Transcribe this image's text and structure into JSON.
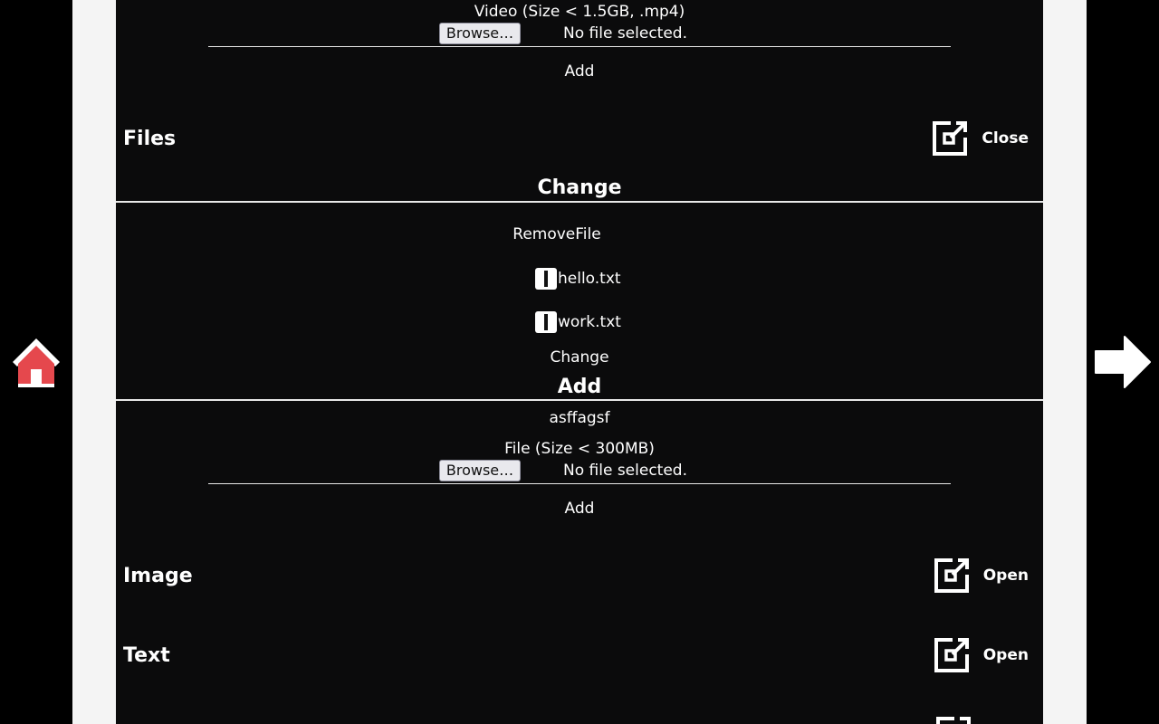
{
  "video_upload": {
    "label": "Video (Size < 1.5GB, .mp4)",
    "browse_label": "Browse…",
    "status": "No file selected.",
    "add_label": "Add"
  },
  "sections": {
    "files": {
      "title": "Files",
      "toggle_label": "Close"
    },
    "image": {
      "title": "Image",
      "toggle_label": "Open"
    },
    "text": {
      "title": "Text",
      "toggle_label": "Open"
    }
  },
  "files_change": {
    "heading": "Change",
    "remove_header": "RemoveFile",
    "files": [
      "hello.txt",
      "work.txt"
    ],
    "change_button": "Change"
  },
  "files_add": {
    "heading": "Add",
    "name_value": "asffagsf",
    "file_label": "File (Size < 300MB)",
    "browse_label": "Browse…",
    "status": "No file selected.",
    "add_label": "Add"
  },
  "icons": {
    "home": "home-icon",
    "next": "arrow-right-icon",
    "toggle": "edit-open-icon"
  },
  "colors": {
    "panel": "#0b0b0c",
    "gutter": "#f4f4f4",
    "home_red": "#e5484d"
  }
}
